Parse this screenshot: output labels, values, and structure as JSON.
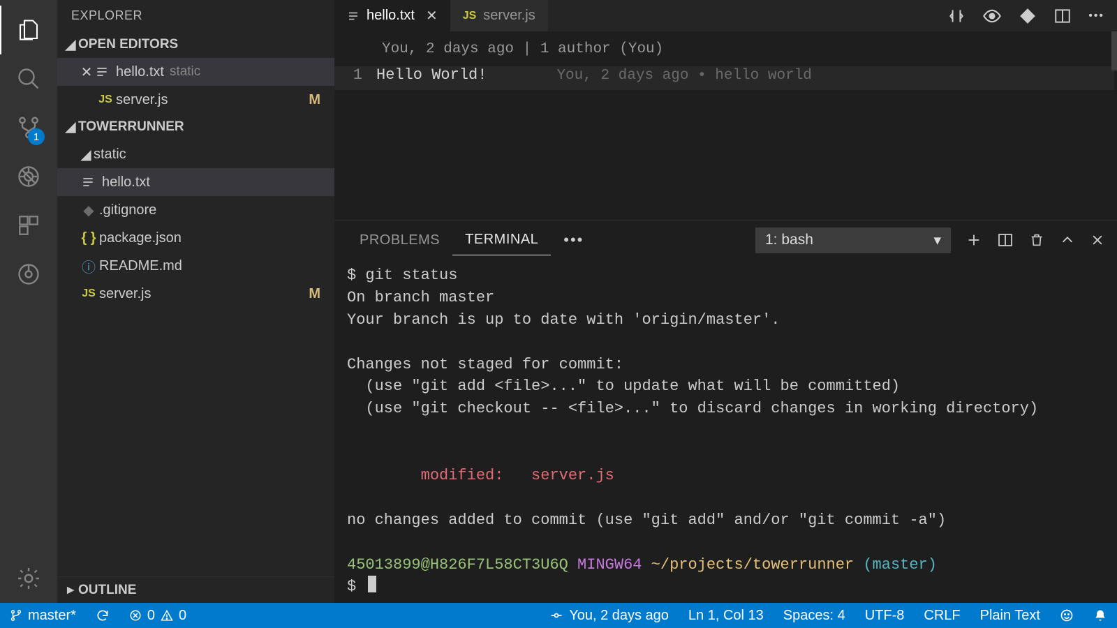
{
  "sidebar": {
    "title": "EXPLORER",
    "open_editors_header": "OPEN EDITORS",
    "open_editors": [
      {
        "name": "hello.txt",
        "tail": "static",
        "modified": ""
      },
      {
        "name": "server.js",
        "tail": "",
        "modified": "M"
      }
    ],
    "project_header": "TOWERRUNNER",
    "folder1": "static",
    "tree": [
      {
        "name": "hello.txt",
        "modified": ""
      },
      {
        "name": ".gitignore",
        "modified": ""
      },
      {
        "name": "package.json",
        "modified": ""
      },
      {
        "name": "README.md",
        "modified": ""
      },
      {
        "name": "server.js",
        "modified": "M"
      }
    ],
    "outline_header": "OUTLINE"
  },
  "activity": {
    "scm_badge": "1"
  },
  "tabs": [
    {
      "name": "hello.txt",
      "active": true,
      "dirty": false
    },
    {
      "name": "server.js",
      "active": false,
      "dirty": false
    }
  ],
  "editor": {
    "codelens": "You, 2 days ago | 1 author (You)",
    "line_number": "1",
    "line_text": "Hello World!",
    "blame": "You, 2 days ago • hello world"
  },
  "panel": {
    "tabs": {
      "problems": "PROBLEMS",
      "terminal": "TERMINAL"
    },
    "more": "•••",
    "select": "1: bash",
    "terminal": {
      "l0": "$ git status",
      "l1": "On branch master",
      "l2": "Your branch is up to date with 'origin/master'.",
      "l3": "",
      "l4": "Changes not staged for commit:",
      "l5": "  (use \"git add <file>...\" to update what will be committed)",
      "l6": "  (use \"git checkout -- <file>...\" to discard changes in working directory)",
      "l7": "",
      "l8": "",
      "l9_a": "        modified:   ",
      "l9_b": "server.js",
      "l10": "",
      "l11": "no changes added to commit (use \"git add\" and/or \"git commit -a\")",
      "l12": "",
      "p_user": "45013899@H826F7L58CT3U6Q",
      "p_sys": " MINGW64",
      "p_path": " ~/projects/towerrunner",
      "p_branch": " (master)",
      "p_prompt": "$ "
    }
  },
  "status": {
    "branch": "master*",
    "errors": "0",
    "warnings": "0",
    "blame": "You, 2 days ago",
    "cursor": "Ln 1, Col 13",
    "spaces": "Spaces: 4",
    "encoding": "UTF-8",
    "eol": "CRLF",
    "lang": "Plain Text"
  }
}
